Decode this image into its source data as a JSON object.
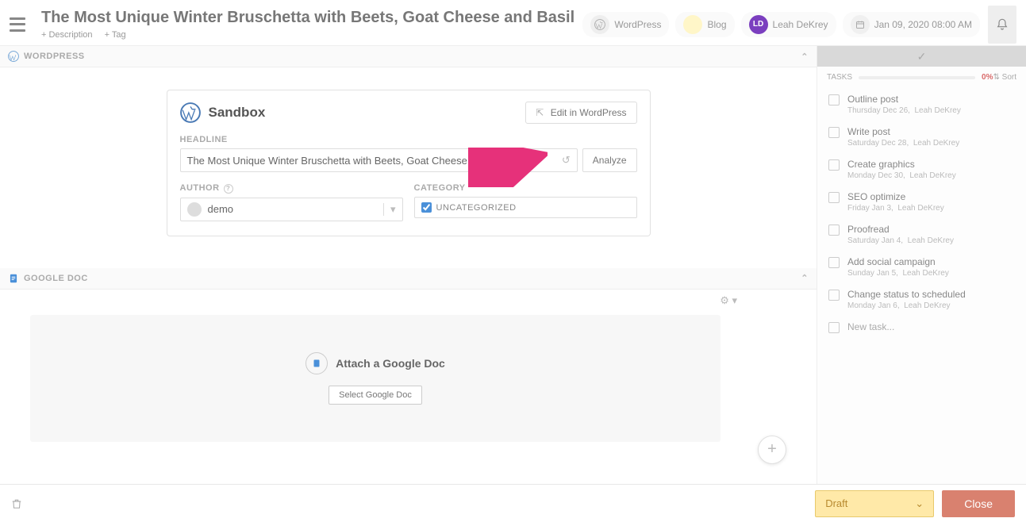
{
  "header": {
    "title": "The Most Unique Winter Bruschetta with Beets, Goat Cheese and Basil",
    "add_description": "+ Description",
    "add_tag": "+ Tag",
    "pills": {
      "wordpress": "WordPress",
      "blog": "Blog",
      "user_initials": "LD",
      "user_name": "Leah DeKrey",
      "date": "Jan 09, 2020 08:00 AM"
    }
  },
  "wordpress": {
    "section_label": "WORDPRESS",
    "card_title": "Sandbox",
    "edit_btn": "Edit in WordPress",
    "headline_label": "HEADLINE",
    "headline_value": "The Most Unique Winter Bruschetta with Beets, Goat Cheese and Basil",
    "analyze_btn": "Analyze",
    "author_label": "AUTHOR",
    "author_value": "demo",
    "category_label": "CATEGORY",
    "category_value": "UNCATEGORIZED"
  },
  "googledoc": {
    "section_label": "GOOGLE DOC",
    "attach_label": "Attach a Google Doc",
    "select_btn": "Select Google Doc"
  },
  "tasks": {
    "label": "TASKS",
    "percent": "0%",
    "sort": "Sort",
    "items": [
      {
        "name": "Outline post",
        "date": "Thursday Dec 26,",
        "owner": "Leah DeKrey"
      },
      {
        "name": "Write post",
        "date": "Saturday Dec 28,",
        "owner": "Leah DeKrey"
      },
      {
        "name": "Create graphics",
        "date": "Monday Dec 30,",
        "owner": "Leah DeKrey"
      },
      {
        "name": "SEO optimize",
        "date": "Friday Jan 3,",
        "owner": "Leah DeKrey"
      },
      {
        "name": "Proofread",
        "date": "Saturday Jan 4,",
        "owner": "Leah DeKrey"
      },
      {
        "name": "Add social campaign",
        "date": "Sunday Jan 5,",
        "owner": "Leah DeKrey"
      },
      {
        "name": "Change status to scheduled",
        "date": "Monday Jan 6,",
        "owner": "Leah DeKrey"
      }
    ],
    "new_task": "New task..."
  },
  "footer": {
    "status": "Draft",
    "close": "Close"
  }
}
